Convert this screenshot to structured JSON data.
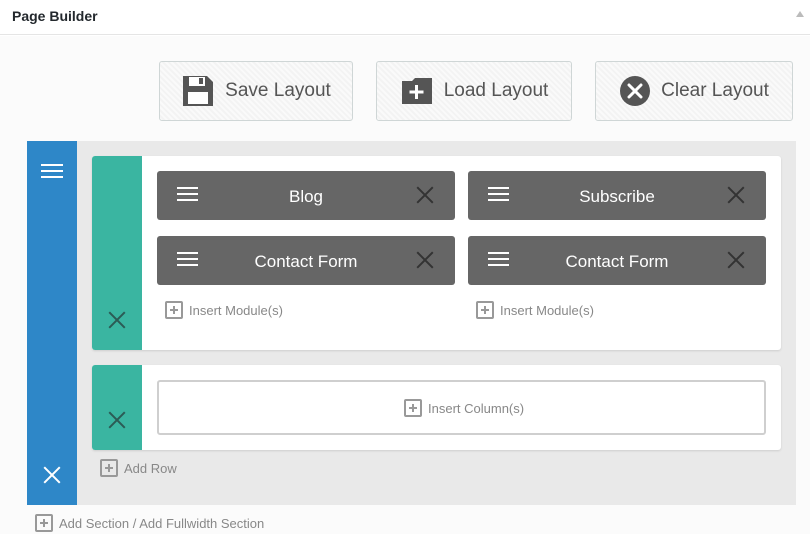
{
  "header": {
    "title": "Page Builder"
  },
  "toolbar": {
    "save_label": "Save Layout",
    "load_label": "Load Layout",
    "clear_label": "Clear Layout"
  },
  "section": {
    "rows": [
      {
        "columns": [
          {
            "modules": [
              "Blog",
              "Contact Form"
            ],
            "insert_label": "Insert Module(s)"
          },
          {
            "modules": [
              "Subscribe",
              "Contact Form"
            ],
            "insert_label": "Insert Module(s)"
          }
        ]
      },
      {
        "insert_column_label": "Insert Column(s)"
      }
    ],
    "add_row_label": "Add Row"
  },
  "add_section_label": "Add Section / Add Fullwidth Section",
  "colors": {
    "section_handle": "#2e87c8",
    "row_handle": "#3ab5a1",
    "module_bg": "#666666",
    "section_bg": "#e9e9e9"
  },
  "icons": [
    "floppy-disk-icon",
    "folder-plus-icon",
    "close-circle-icon",
    "hamburger-icon",
    "close-icon",
    "plus-square-icon",
    "collapse-arrow-icon"
  ]
}
